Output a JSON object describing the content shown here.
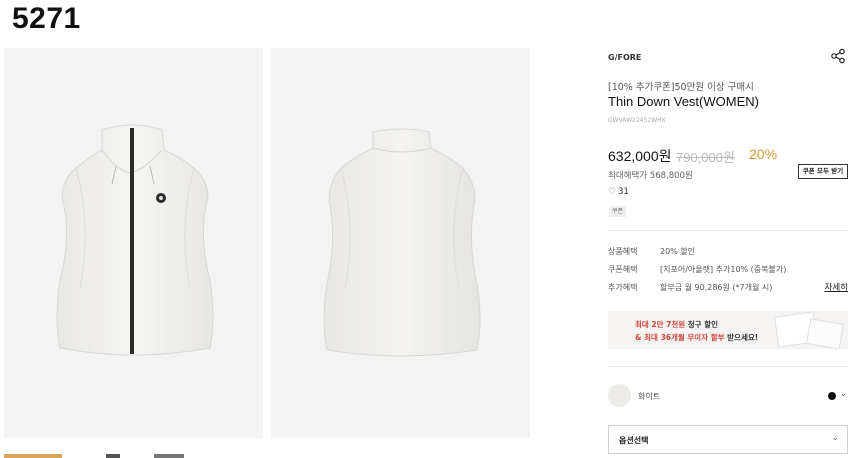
{
  "page_number": "5271",
  "product": {
    "brand": "G/FORE",
    "promo_line": "[10% 추가쿠폰]50만원 이상 구매시",
    "name": "Thin Down Vest(WOMEN)",
    "code": "GWVAW22452WHX",
    "price": "632,000원",
    "original_price": "790,000원",
    "discount": "20%",
    "max_benefit": "최대혜택가 568,800원",
    "coupon_button": "쿠폰 모두 받기",
    "likes": "31",
    "tag": "쿠폰"
  },
  "benefits": [
    {
      "label": "상품혜택",
      "value": "20% 할인"
    },
    {
      "label": "쿠폰혜택",
      "value": "[지포어/아울렛] 추가10% (중복불가)"
    },
    {
      "label": "추가혜택",
      "value": "할부금 월 90,286원 (*7개월 시)",
      "link": "자세히"
    }
  ],
  "banner": {
    "line1_red": "최대 2만 7천원",
    "line1_rest": " 청구 할인",
    "line2_red": "& 최대 36개월 무이자 할부",
    "line2_rest": " 받으세요!"
  },
  "color_option": {
    "label": "화이트",
    "dot_color": "#111111",
    "swatch_color": "#ecebe8"
  },
  "option_select": {
    "label": "옵션선택"
  },
  "colors": {
    "accent": "#d59a3b",
    "banner_red": "#d0463b",
    "thumb_active": "#d9a35a"
  },
  "icons": {
    "share": "share-icon",
    "heart": "heart-icon",
    "chevron": "chevron-down-icon"
  }
}
